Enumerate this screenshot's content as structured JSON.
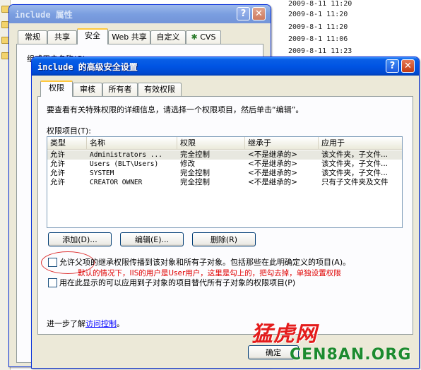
{
  "background": {
    "dates": [
      "2009-8-11 11:20",
      "2009-8-1 11:20",
      "2009-8-1 11:20",
      "2009-8-1 11:06",
      "2009-8-11 11:23"
    ]
  },
  "properties_window": {
    "title": "include 属性",
    "help_btn": "?",
    "close_btn": "✕",
    "tabs": [
      "常规",
      "共享",
      "安全",
      "Web 共享",
      "自定义",
      "CVS"
    ],
    "active_tab": "安全",
    "group_label": "组或用户名称(G):"
  },
  "advanced_window": {
    "title": "include 的高级安全设置",
    "help_btn": "?",
    "close_btn": "✕",
    "tabs": [
      "权限",
      "审核",
      "所有者",
      "有效权限"
    ],
    "intro": "要查看有关特殊权限的详细信息，请选择一个权限项目，然后单击“编辑”。",
    "list_label": "权限项目(T):",
    "columns": [
      "类型",
      "名称",
      "权限",
      "继承于",
      "应用于"
    ],
    "rows": [
      {
        "type": "允许",
        "name": "Administrators ...",
        "perm": "完全控制",
        "inherit": "<不是继承的>",
        "apply": "该文件夹，子文件..."
      },
      {
        "type": "允许",
        "name": "Users (BLT\\Users)",
        "perm": "修改",
        "inherit": "<不是继承的>",
        "apply": "该文件夹，子文件..."
      },
      {
        "type": "允许",
        "name": "SYSTEM",
        "perm": "完全控制",
        "inherit": "<不是继承的>",
        "apply": "该文件夹，子文件..."
      },
      {
        "type": "允许",
        "name": "CREATOR OWNER",
        "perm": "完全控制",
        "inherit": "<不是继承的>",
        "apply": "只有子文件夹及文件"
      }
    ],
    "add_btn": "添加(D)...",
    "edit_btn": "编辑(E)...",
    "remove_btn": "删除(R)",
    "inherit_checkbox": "允许父项的继承权限传播到该对象和所有子对象。包括那些在此明确定义的项目(A)。",
    "annotation": "默认的情况下，IIS的用户是User用户，这里是勾上的，把勾去掉，单独设置权限",
    "replace_checkbox": "用在此显示的可以应用到子对象的项目替代所有子对象的权限项目(P)",
    "learn_more_prefix": "进一步了解",
    "learn_more_link": "访问控制",
    "learn_more_suffix": "。",
    "ok_btn": "确定"
  },
  "watermark": {
    "cn": "猛虎网",
    "en": "CEN8AN.ORG"
  },
  "colors": {
    "title_active": "#0054e3",
    "window_bg": "#ece9d8",
    "annotation_red": "#e00000",
    "tab_highlight": "#ffc83c"
  }
}
